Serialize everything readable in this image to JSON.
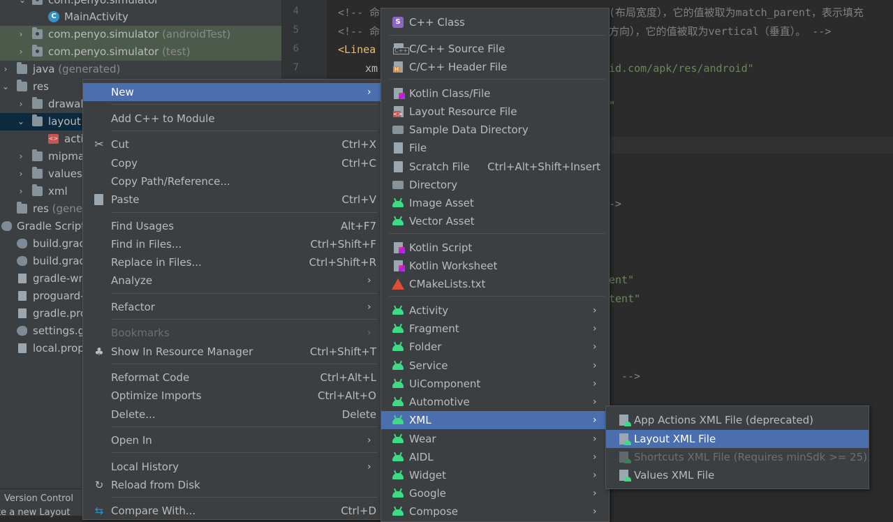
{
  "project_tree": {
    "rows": [
      {
        "label": "com.penyo.simulator",
        "suffix": "",
        "icon": "package-folder-icon",
        "expanded": true
      },
      {
        "label": "MainActivity",
        "suffix": "",
        "icon": "class-icon"
      },
      {
        "label": "com.penyo.simulator",
        "suffix": " (androidTest)",
        "icon": "package-folder-icon",
        "expanded": false
      },
      {
        "label": "com.penyo.simulator",
        "suffix": " (test)",
        "icon": "package-folder-icon",
        "expanded": false
      },
      {
        "label": "java",
        "suffix": " (generated)",
        "icon": "folder-icon",
        "expanded": false
      },
      {
        "label": "res",
        "suffix": "",
        "icon": "folder-icon",
        "expanded": true
      },
      {
        "label": "drawab",
        "suffix": "",
        "icon": "folder-icon",
        "expanded": false
      },
      {
        "label": "layout",
        "suffix": "",
        "icon": "folder-icon",
        "expanded": true
      },
      {
        "label": "acti",
        "suffix": "",
        "icon": "layout-xml-icon"
      },
      {
        "label": "mipma",
        "suffix": "",
        "icon": "folder-icon",
        "expanded": false
      },
      {
        "label": "values",
        "suffix": "",
        "icon": "folder-icon",
        "expanded": false
      },
      {
        "label": "xml",
        "suffix": "",
        "icon": "folder-icon",
        "expanded": false
      },
      {
        "label": "res",
        "suffix": " (gener",
        "icon": "folder-icon"
      },
      {
        "label": "Gradle Script",
        "suffix": "",
        "icon": "gradle-icon",
        "expanded": true
      },
      {
        "label": "build.grad",
        "suffix": "",
        "icon": "gradle-icon"
      },
      {
        "label": "build.grad",
        "suffix": "",
        "icon": "gradle-icon"
      },
      {
        "label": "gradle-wr",
        "suffix": "",
        "icon": "properties-file-icon"
      },
      {
        "label": "proguard-",
        "suffix": "",
        "icon": "file-icon"
      },
      {
        "label": "gradle.pro",
        "suffix": "",
        "icon": "properties-file-icon"
      },
      {
        "label": "settings.g",
        "suffix": "",
        "icon": "gradle-icon"
      },
      {
        "label": "local.prop",
        "suffix": "",
        "icon": "properties-file-icon"
      }
    ],
    "version_control_label": "Version Control",
    "status_text": "te a new Layout"
  },
  "editor": {
    "line_numbers": [
      "4",
      "5",
      "6",
      "7"
    ],
    "lines": {
      "l4_comment_a": "<!-- 命",
      "l4_comment_b": "(布局宽度），它的值被取为match_parent，表示填充",
      "l5_comment_a": "<!-- 命",
      "l5_comment_b": "方向），它的值被取为vertical（垂直）。 -->",
      "l6_tag": "<Linea",
      "l7_attr": "xm",
      "l7_value": "id.com/apk/res/android\"",
      "l9_value": "\"",
      "l12_value": "->",
      "l16_value": "ent\"",
      "l17_value": "tent\"",
      "l21_value": "-->"
    }
  },
  "context_menu": {
    "items": [
      {
        "label": "New",
        "shortcut": "",
        "submenu": true,
        "active": true
      },
      {
        "label": "Add C++ to Module",
        "shortcut": ""
      },
      {
        "label": "Cut",
        "shortcut": "Ctrl+X",
        "icon": "scissors-icon"
      },
      {
        "label": "Copy",
        "shortcut": "Ctrl+C"
      },
      {
        "label": "Copy Path/Reference...",
        "shortcut": ""
      },
      {
        "label": "Paste",
        "shortcut": "Ctrl+V",
        "icon": "clipboard-icon"
      },
      {
        "label": "Find Usages",
        "shortcut": "Alt+F7"
      },
      {
        "label": "Find in Files...",
        "shortcut": "Ctrl+Shift+F"
      },
      {
        "label": "Replace in Files...",
        "shortcut": "Ctrl+Shift+R"
      },
      {
        "label": "Analyze",
        "shortcut": "",
        "submenu": true
      },
      {
        "label": "Refactor",
        "shortcut": "",
        "submenu": true
      },
      {
        "label": "Bookmarks",
        "shortcut": "",
        "submenu": true,
        "disabled": true
      },
      {
        "label": "Show In Resource Manager",
        "shortcut": "Ctrl+Shift+T",
        "icon": "resource-manager-icon"
      },
      {
        "label": "Reformat Code",
        "shortcut": "Ctrl+Alt+L"
      },
      {
        "label": "Optimize Imports",
        "shortcut": "Ctrl+Alt+O"
      },
      {
        "label": "Delete...",
        "shortcut": "Delete"
      },
      {
        "label": "Open In",
        "shortcut": "",
        "submenu": true
      },
      {
        "label": "Local History",
        "shortcut": "",
        "submenu": true
      },
      {
        "label": "Reload from Disk",
        "shortcut": "",
        "icon": "reload-icon"
      },
      {
        "label": "Compare With...",
        "shortcut": "Ctrl+D",
        "icon": "compare-icon"
      }
    ]
  },
  "new_submenu": {
    "items": [
      {
        "label": "C++ Class",
        "icon": "cpp-class-icon"
      },
      {
        "label": "C/C++ Source File",
        "icon": "cpp-source-file-icon"
      },
      {
        "label": "C/C++ Header File",
        "icon": "cpp-header-file-icon"
      },
      {
        "label": "Kotlin Class/File",
        "icon": "kotlin-file-icon"
      },
      {
        "label": "Layout Resource File",
        "icon": "layout-file-icon"
      },
      {
        "label": "Sample Data Directory",
        "icon": "folder-icon"
      },
      {
        "label": "File",
        "icon": "file-icon"
      },
      {
        "label": "Scratch File",
        "shortcut": "Ctrl+Alt+Shift+Insert",
        "icon": "scratch-file-icon"
      },
      {
        "label": "Directory",
        "icon": "folder-icon"
      },
      {
        "label": "Image Asset",
        "icon": "android-icon"
      },
      {
        "label": "Vector Asset",
        "icon": "android-icon"
      },
      {
        "label": "Kotlin Script",
        "icon": "kotlin-file-icon"
      },
      {
        "label": "Kotlin Worksheet",
        "icon": "kotlin-file-icon"
      },
      {
        "label": "CMakeLists.txt",
        "icon": "cmake-icon"
      },
      {
        "label": "Activity",
        "icon": "android-icon",
        "submenu": true
      },
      {
        "label": "Fragment",
        "icon": "android-icon",
        "submenu": true
      },
      {
        "label": "Folder",
        "icon": "android-icon",
        "submenu": true
      },
      {
        "label": "Service",
        "icon": "android-icon",
        "submenu": true
      },
      {
        "label": "UiComponent",
        "icon": "android-icon",
        "submenu": true
      },
      {
        "label": "Automotive",
        "icon": "android-icon",
        "submenu": true
      },
      {
        "label": "XML",
        "icon": "android-icon",
        "submenu": true,
        "active": true
      },
      {
        "label": "Wear",
        "icon": "android-icon",
        "submenu": true
      },
      {
        "label": "AIDL",
        "icon": "android-icon",
        "submenu": true
      },
      {
        "label": "Widget",
        "icon": "android-icon",
        "submenu": true
      },
      {
        "label": "Google",
        "icon": "android-icon",
        "submenu": true
      },
      {
        "label": "Compose",
        "icon": "android-icon",
        "submenu": true
      }
    ]
  },
  "xml_submenu": {
    "items": [
      {
        "label": "App Actions XML File (deprecated)",
        "icon": "xml-file-icon"
      },
      {
        "label": "Layout XML File",
        "icon": "xml-file-icon",
        "active": true
      },
      {
        "label": "Shortcuts XML File (Requires minSdk >= 25)",
        "icon": "xml-file-icon",
        "disabled": true
      },
      {
        "label": "Values XML File",
        "icon": "xml-file-icon"
      }
    ]
  },
  "colors": {
    "menu_bg": "#3c3f41",
    "highlight": "#4b6eaf",
    "editor_bg": "#2b2b2b",
    "android_green": "#3ddc84"
  }
}
